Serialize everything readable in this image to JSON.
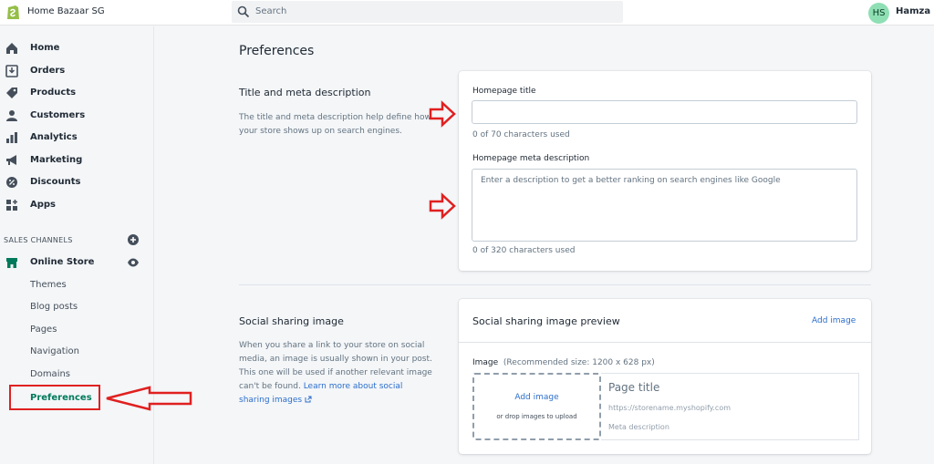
{
  "topbar": {
    "store_name": "Home Bazaar SG",
    "search_placeholder": "Search",
    "user_initials": "HS",
    "user_name": "Hamza Sh"
  },
  "sidebar": {
    "items": [
      {
        "label": "Home",
        "icon": "home-icon"
      },
      {
        "label": "Orders",
        "icon": "orders-icon"
      },
      {
        "label": "Products",
        "icon": "tag-icon"
      },
      {
        "label": "Customers",
        "icon": "person-icon"
      },
      {
        "label": "Analytics",
        "icon": "bar-chart-icon"
      },
      {
        "label": "Marketing",
        "icon": "megaphone-icon"
      },
      {
        "label": "Discounts",
        "icon": "discount-icon"
      },
      {
        "label": "Apps",
        "icon": "apps-icon"
      }
    ],
    "sales_channels_heading": "SALES CHANNELS",
    "online_store_label": "Online Store",
    "sub_items": [
      {
        "label": "Themes"
      },
      {
        "label": "Blog posts"
      },
      {
        "label": "Pages"
      },
      {
        "label": "Navigation"
      },
      {
        "label": "Domains"
      },
      {
        "label": "Preferences"
      }
    ]
  },
  "main": {
    "page_title": "Preferences",
    "meta_section": {
      "title": "Title and meta description",
      "description": "The title and meta description help define how your store shows up on search engines.",
      "homepage_title_label": "Homepage title",
      "homepage_title_value": "",
      "homepage_title_help": "0 of 70 characters used",
      "meta_description_label": "Homepage meta description",
      "meta_description_placeholder": "Enter a description to get a better ranking on search engines like Google",
      "meta_description_help": "0 of 320 characters used"
    },
    "social_section": {
      "title": "Social sharing image",
      "description": "When you share a link to your store on social media, an image is usually shown in your post. This one will be used if another relevant image can't be found.",
      "learn_more": "Learn more about social sharing images",
      "card_title": "Social sharing image preview",
      "add_image_action": "Add image",
      "image_label": "Image",
      "image_hint": "(Recommended size: 1200 x 628 px)",
      "drop_add_image": "Add image",
      "drop_text": "or drop images to upload",
      "preview_title": "Page title",
      "preview_url": "https://storename.myshopify.com",
      "preview_description": "Meta description"
    }
  },
  "colors": {
    "accent_green": "#007a5c",
    "link_blue": "#2c6ecb",
    "annotation_red": "#e02020",
    "logo_green": "#95bf47"
  }
}
